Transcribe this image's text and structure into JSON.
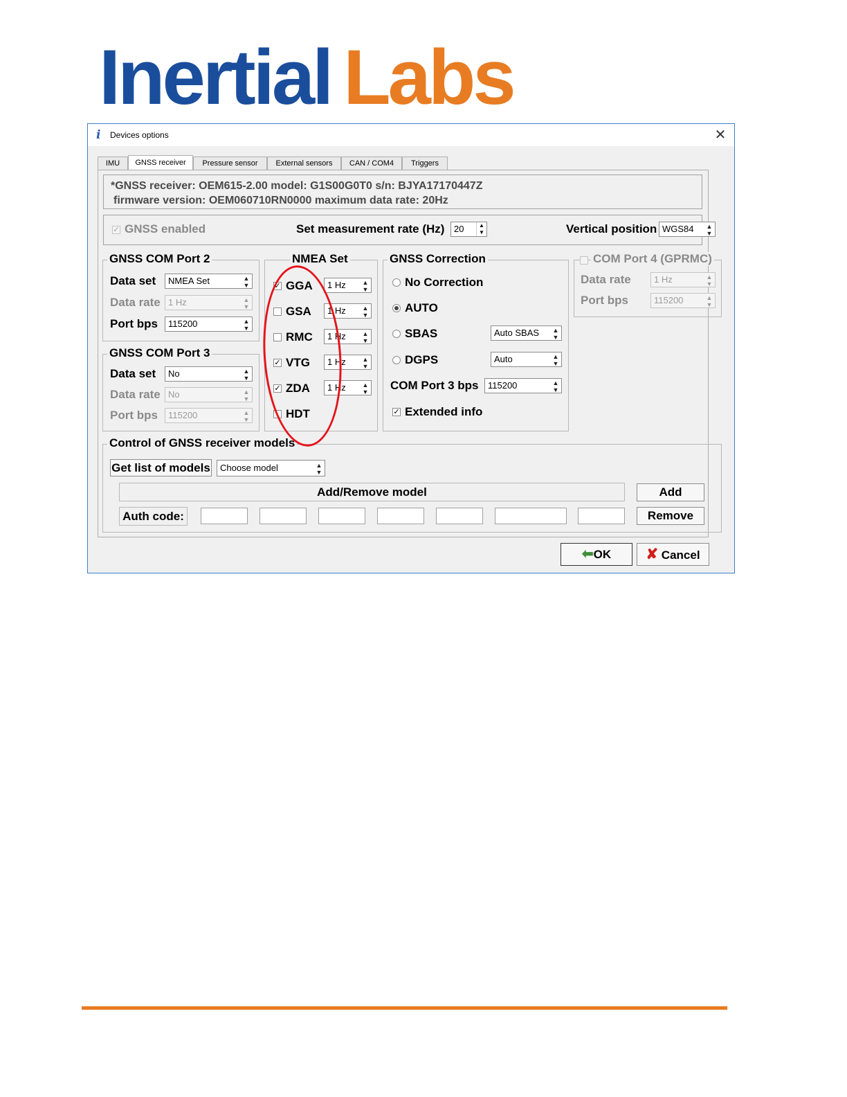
{
  "logo": {
    "part1": "Inertial",
    "part2": "Labs",
    "color1": "#1a4e9c",
    "color2": "#e87c22"
  },
  "window": {
    "title": "Devices options",
    "icon": "info-icon",
    "close": "✕"
  },
  "tabs": [
    {
      "label": "IMU"
    },
    {
      "label": "GNSS receiver",
      "active": true
    },
    {
      "label": "Pressure sensor"
    },
    {
      "label": "External sensors"
    },
    {
      "label": "CAN / COM4"
    },
    {
      "label": "Triggers"
    }
  ],
  "info": {
    "line1": "*GNSS receiver: OEM615-2.00 model: G1S00G0T0 s/n: BJYA17170447Z",
    "line2": "firmware version: OEM060710RN0000 maximum data rate: 20Hz"
  },
  "general": {
    "gnss_enabled_label": "GNSS enabled",
    "gnss_enabled": true,
    "meas_rate_label": "Set measurement rate (Hz)",
    "meas_rate_value": "20",
    "vertical_position_label": "Vertical position",
    "vertical_position_value": "WGS84"
  },
  "com2": {
    "title": "GNSS COM Port 2",
    "data_set_label": "Data set",
    "data_set_value": "NMEA Set",
    "data_rate_label": "Data rate",
    "data_rate_value": "1 Hz",
    "port_bps_label": "Port bps",
    "port_bps_value": "115200"
  },
  "com3": {
    "title": "GNSS COM Port 3",
    "data_set_label": "Data set",
    "data_set_value": "No",
    "data_rate_label": "Data rate",
    "data_rate_value": "No",
    "port_bps_label": "Port bps",
    "port_bps_value": "115200"
  },
  "nmea": {
    "title": "NMEA Set",
    "items": [
      {
        "label": "GGA",
        "checked": true,
        "rate": "1 Hz"
      },
      {
        "label": "GSA",
        "checked": false,
        "rate": "1 Hz"
      },
      {
        "label": "RMC",
        "checked": false,
        "rate": "1 Hz"
      },
      {
        "label": "VTG",
        "checked": true,
        "rate": "1 Hz"
      },
      {
        "label": "ZDA",
        "checked": true,
        "rate": "1 Hz"
      },
      {
        "label": "HDT",
        "checked": false
      }
    ]
  },
  "correction": {
    "title": "GNSS Correction",
    "no_correction": "No Correction",
    "auto": "AUTO",
    "sbas": "SBAS",
    "sbas_value": "Auto SBAS",
    "dgps": "DGPS",
    "dgps_value": "Auto",
    "com3_bps_label": "COM Port 3 bps",
    "com3_bps_value": "115200",
    "extended_info": "Extended info",
    "selected": "AUTO"
  },
  "com4": {
    "title": "COM Port 4 (GPRMC)",
    "data_rate_label": "Data rate",
    "data_rate_value": "1 Hz",
    "port_bps_label": "Port bps",
    "port_bps_value": "115200"
  },
  "models": {
    "title": "Control of GNSS receiver models",
    "get_list_label": "Get list of models",
    "choose_model": "Choose model",
    "add_remove_label": "Add/Remove model",
    "auth_code_label": "Auth code:",
    "add_label": "Add",
    "remove_label": "Remove"
  },
  "buttons": {
    "ok": "OK",
    "cancel": "Cancel"
  },
  "colors": {
    "accent_border": "#3c7fc8",
    "annotation": "#e5141b",
    "footer_line": "#e87c22"
  }
}
